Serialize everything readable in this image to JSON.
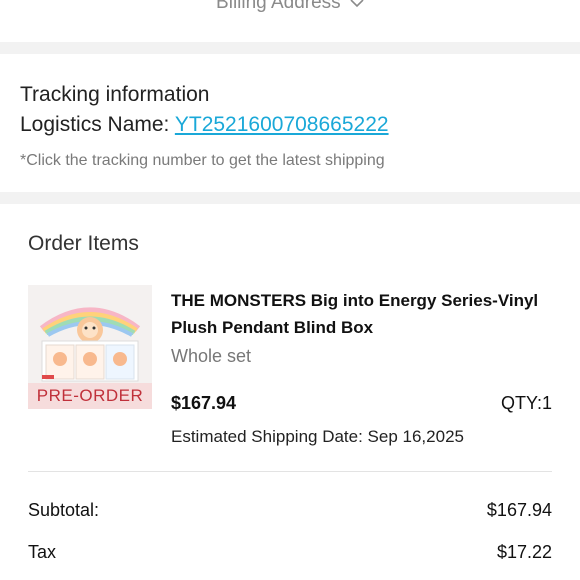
{
  "billing": {
    "label": "Billing Address"
  },
  "tracking": {
    "title": "Tracking information",
    "logistics_label": "Logistics Name: ",
    "tracking_number": "YT2521600708665222",
    "hint": "*Click the tracking number to get the latest shipping"
  },
  "order": {
    "title": "Order Items",
    "item": {
      "name": "THE MONSTERS Big into Energy Series-Vinyl Plush Pendant Blind Box",
      "variant": "Whole set",
      "badge": "PRE-ORDER",
      "price": "$167.94",
      "qty": "QTY:1",
      "shipping": "Estimated Shipping Date: Sep 16,2025"
    }
  },
  "summary": {
    "subtotal_label": "Subtotal:",
    "subtotal_value": "$167.94",
    "tax_label": "Tax",
    "tax_value": "$17.22"
  },
  "colors": {
    "link": "#1aa8d8",
    "badge_text": "#c0303a",
    "badge_bg": "#f6dcdc",
    "divider": "#f2f2f2"
  },
  "icons": {
    "billing_toggle": "chevron-down-icon"
  }
}
